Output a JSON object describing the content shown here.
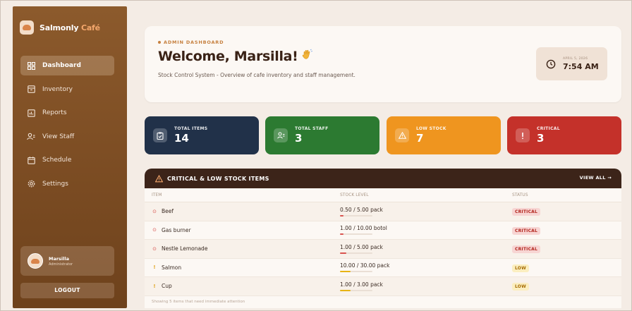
{
  "app": {
    "name": "Salmonly",
    "name_accent": "Café"
  },
  "sidebar": {
    "items": [
      {
        "label": "Dashboard",
        "icon": "dashboard-icon",
        "active": true
      },
      {
        "label": "Inventory",
        "icon": "inventory-icon",
        "active": false
      },
      {
        "label": "Reports",
        "icon": "reports-icon",
        "active": false
      },
      {
        "label": "View Staff",
        "icon": "staff-icon",
        "active": false
      },
      {
        "label": "Schedule",
        "icon": "calendar-icon",
        "active": false
      },
      {
        "label": "Settings",
        "icon": "gear-icon",
        "active": false
      }
    ],
    "user": {
      "name": "Marsilla",
      "role": "Administrator"
    },
    "logout_label": "LOGOUT"
  },
  "header": {
    "eyebrow": "ADMIN DASHBOARD",
    "title": "Welcome, Marsilla!",
    "subtitle": "Stock Control System - Overview of cafe inventory and staff management.",
    "date": "APRIL 5, 2026",
    "time": "7:54 AM"
  },
  "stats": [
    {
      "label": "TOTAL ITEMS",
      "value": "14",
      "color": "#213149",
      "icon": "clipboard-icon"
    },
    {
      "label": "TOTAL STAFF",
      "value": "3",
      "color": "#2c7a31",
      "icon": "staff-icon"
    },
    {
      "label": "LOW STOCK",
      "value": "7",
      "color": "#ef951f",
      "icon": "warning-icon"
    },
    {
      "label": "CRITICAL",
      "value": "3",
      "color": "#c4312a",
      "icon": "alert-icon"
    }
  ],
  "table": {
    "title": "CRITICAL & LOW STOCK ITEMS",
    "view_all": "VIEW ALL →",
    "columns": [
      "ITEM",
      "STOCK LEVEL",
      "STATUS"
    ],
    "rows": [
      {
        "item": "Beef",
        "stock": "0.50 / 5.00 pack",
        "level": 0.1,
        "status": "CRITICAL",
        "kind": "crit"
      },
      {
        "item": "Gas burner",
        "stock": "1.00 / 10.00 botol",
        "level": 0.1,
        "status": "CRITICAL",
        "kind": "crit"
      },
      {
        "item": "Nestle Lemonade",
        "stock": "1.00 / 5.00 pack",
        "level": 0.2,
        "status": "CRITICAL",
        "kind": "crit"
      },
      {
        "item": "Salmon",
        "stock": "10.00 / 30.00 pack",
        "level": 0.33,
        "status": "LOW",
        "kind": "low"
      },
      {
        "item": "Cup",
        "stock": "1.00 / 3.00 pack",
        "level": 0.33,
        "status": "LOW",
        "kind": "low"
      }
    ],
    "footnote": "Showing 5 items that need immediate attention"
  },
  "colors": {
    "crit": "#d9534f",
    "low": "#e7b416"
  }
}
